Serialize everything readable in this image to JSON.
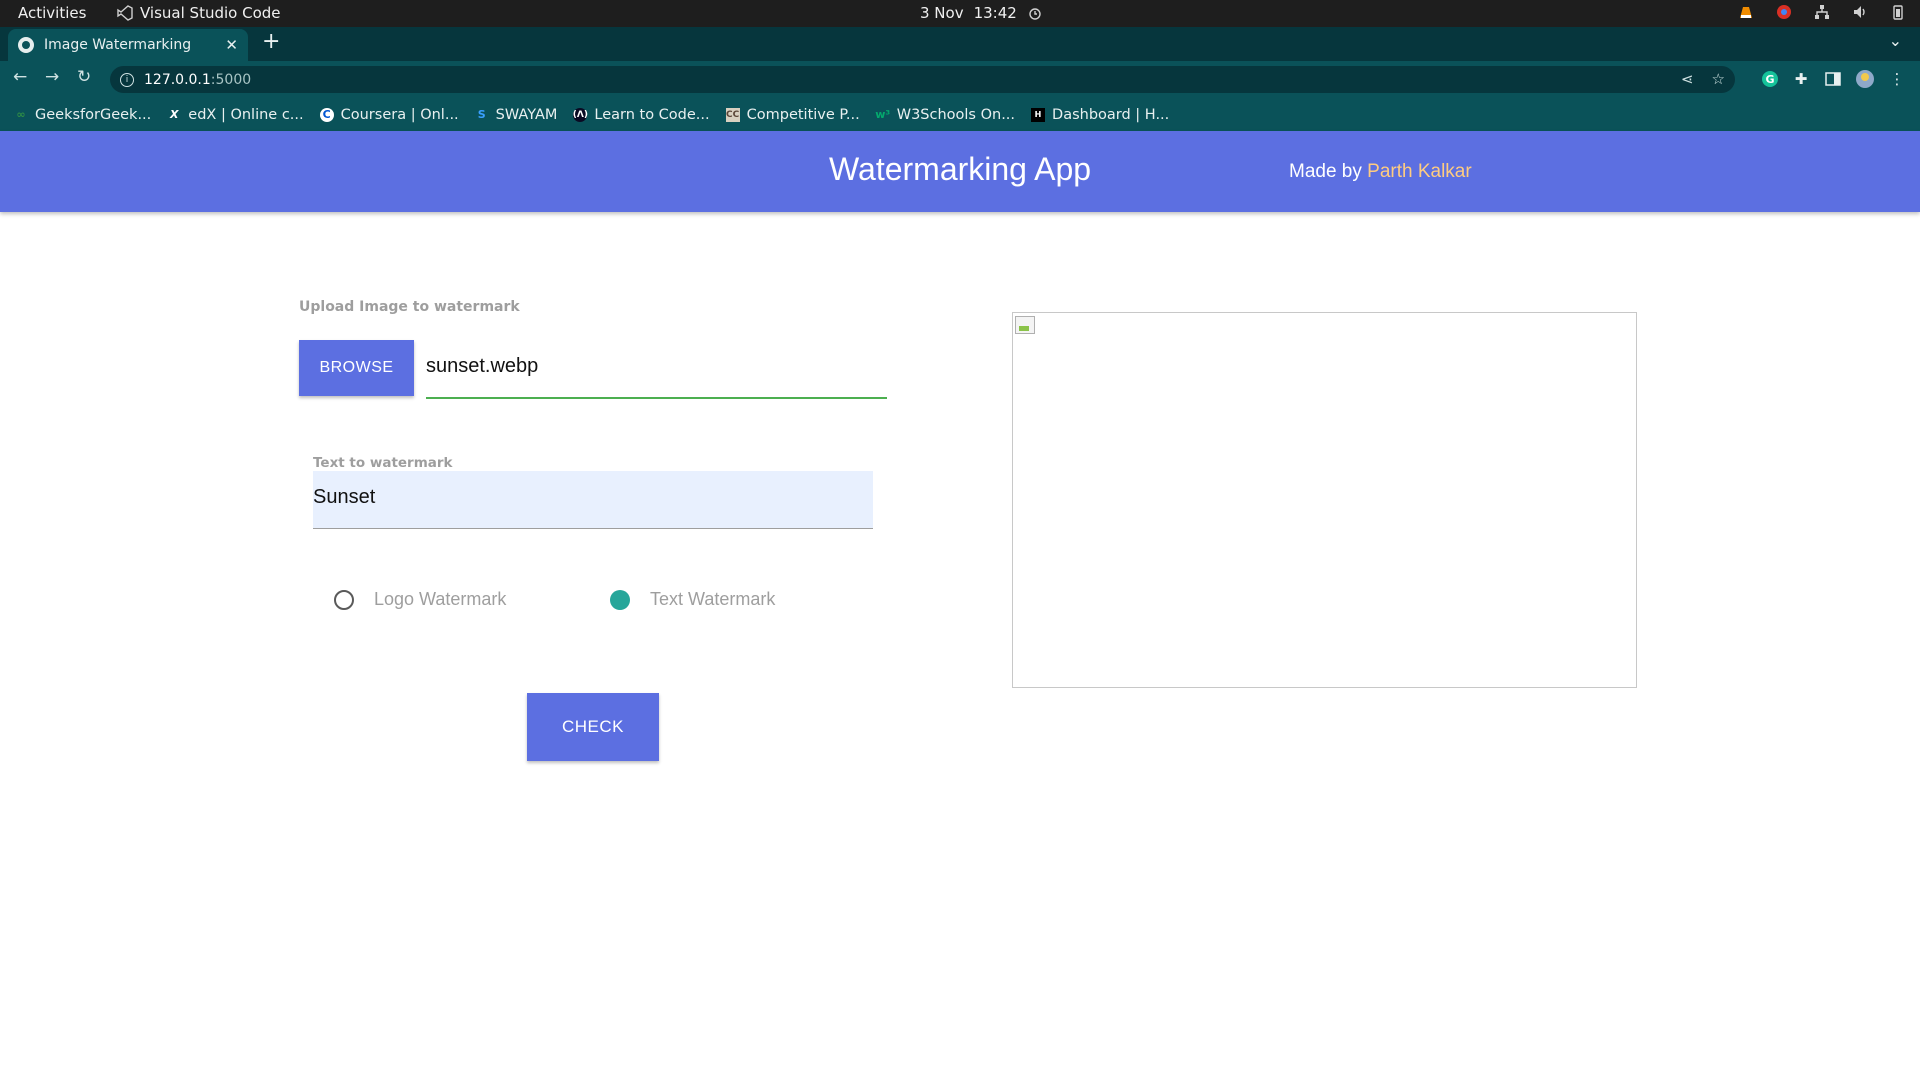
{
  "os_bar": {
    "activities": "Activities",
    "app_name": "Visual Studio Code",
    "date": "3 Nov",
    "time": "13:42"
  },
  "browser": {
    "tab_title": "Image Watermarking",
    "tab_close": "✕",
    "new_tab": "+",
    "url_host": "127.0.0.1",
    "url_port": ":5000",
    "bookmarks": [
      {
        "label": "GeeksforGeek...",
        "icon": "geeksforgeeks-icon"
      },
      {
        "label": "edX | Online c...",
        "icon": "edx-icon"
      },
      {
        "label": "Coursera | Onl...",
        "icon": "coursera-icon"
      },
      {
        "label": "SWAYAM",
        "icon": "swayam-icon"
      },
      {
        "label": "Learn to Code...",
        "icon": "freecodecamp-icon"
      },
      {
        "label": "Competitive P...",
        "icon": "codechef-icon"
      },
      {
        "label": "W3Schools On...",
        "icon": "w3schools-icon"
      },
      {
        "label": "Dashboard | H...",
        "icon": "hackerrank-icon"
      }
    ]
  },
  "navbar": {
    "brand": "Watermarking App",
    "made_by": "Made by",
    "author": "Parth Kalkar",
    "color": "#5c6fe1",
    "author_color": "#ffcc80"
  },
  "form": {
    "upload_label": "Upload Image to watermark",
    "browse_label": "BROWSE",
    "file_name": "sunset.webp",
    "text_label": "Text to watermark",
    "text_value": "Sunset",
    "radio_logo": "Logo Watermark",
    "radio_text": "Text Watermark",
    "selected": "Text Watermark",
    "check_label": "CHECK",
    "accent_color": "#26a69a"
  }
}
